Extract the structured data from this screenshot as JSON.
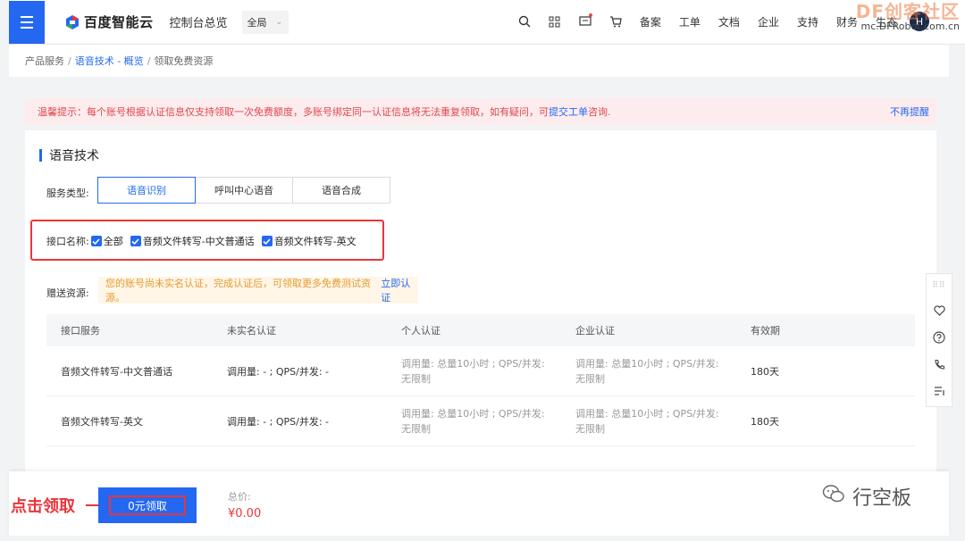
{
  "header": {
    "logo_text": "百度智能云",
    "console_link": "控制台总览",
    "scope_select": "全局",
    "nav_items": [
      "备案",
      "工单",
      "文档",
      "企业",
      "支持",
      "财务",
      "生态"
    ],
    "avatar_initial": "H",
    "watermark_main": "DF创客社区",
    "watermark_sub": "mc.DFRobot.com.cn"
  },
  "breadcrumb": {
    "item1": "产品服务",
    "item2": "语音技术 - 概览",
    "item3": "领取免费资源",
    "separator": "/"
  },
  "notice": {
    "text": "温馨提示：每个账号根据认证信息仅支持领取一次免费额度，多账号绑定同一认证信息将无法重复领取，如有疑问，可",
    "link": "提交工单",
    "suffix": "咨询.",
    "dismiss": "不再提醒"
  },
  "card": {
    "title": "语音技术",
    "service_label": "服务类型:",
    "service_tabs": [
      {
        "label": "语音识别",
        "active": true
      },
      {
        "label": "呼叫中心语音",
        "active": false
      },
      {
        "label": "语音合成",
        "active": false
      }
    ],
    "api_label": "接口名称:",
    "api_checkboxes": [
      {
        "label": "全部",
        "checked": true
      },
      {
        "label": "音频文件转写-中文普通话",
        "checked": true
      },
      {
        "label": "音频文件转写-英文",
        "checked": true
      }
    ],
    "gift_label": "赠送资源:",
    "gift_tip": "您的账号尚未实名认证，完成认证后，可领取更多免费测试资源。",
    "gift_link": "立即认证"
  },
  "table": {
    "headers": [
      "接口服务",
      "未实名认证",
      "个人认证",
      "企业认证",
      "有效期"
    ],
    "rows": [
      [
        "音频文件转写-中文普通话",
        "调用量: - ; QPS/并发: -",
        "调用量: 总量10小时 ; QPS/并发: 无限制",
        "调用量: 总量10小时 ; QPS/并发: 无限制",
        "180天"
      ],
      [
        "音频文件转写-英文",
        "调用量: - ; QPS/并发: -",
        "调用量: 总量10小时 ; QPS/并发: 无限制",
        "调用量: 总量10小时 ; QPS/并发: 无限制",
        "180天"
      ]
    ]
  },
  "footer": {
    "annotation": "点击领取",
    "claim_button": "0元领取",
    "total_label": "总价:",
    "total_value": "¥0.00",
    "watermark": "行空板"
  },
  "colors": {
    "brand_blue": "#2468f2",
    "alert_red": "#e8363b",
    "tip_orange": "#e69a2e"
  },
  "icons": {
    "nav": [
      "search-icon",
      "grid-icon",
      "message-icon",
      "cart-icon"
    ],
    "float": [
      "drag-handle-icon",
      "heart-icon",
      "help-icon",
      "phone-icon",
      "list-icon"
    ]
  }
}
